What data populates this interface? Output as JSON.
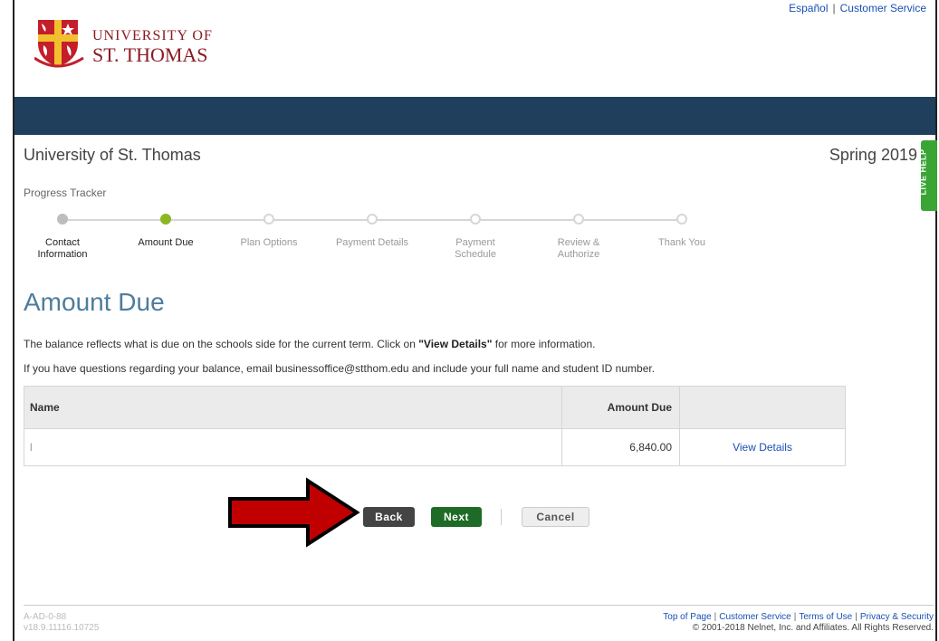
{
  "top_links": {
    "espanol": "Español",
    "customer_service": "Customer Service"
  },
  "logo": {
    "line1": "UNIVERSITY OF",
    "line2": "ST. THOMAS"
  },
  "colors": {
    "banner": "#1f3f5c",
    "title": "#4e7c9c",
    "current_step": "#8cb623",
    "next_button": "#1d6b26",
    "live_help": "#3aa535",
    "arrow": "#c00000"
  },
  "header": {
    "school": "University of St. Thomas",
    "term": "Spring 2019",
    "live_help": "LIVE HELP"
  },
  "tracker": {
    "title": "Progress Tracker",
    "steps": [
      {
        "label": "Contact Information",
        "state": "done"
      },
      {
        "label": "Amount Due",
        "state": "current"
      },
      {
        "label": "Plan Options",
        "state": "future"
      },
      {
        "label": "Payment Details",
        "state": "future"
      },
      {
        "label": "Payment Schedule",
        "state": "future"
      },
      {
        "label": "Review & Authorize",
        "state": "future"
      },
      {
        "label": "Thank You",
        "state": "future"
      }
    ]
  },
  "main": {
    "title": "Amount Due",
    "para1_prefix": "The balance reflects what is due on the schools side for the current term. Click on ",
    "para1_bold": "\"View Details\"",
    "para1_suffix": " for more information.",
    "para2": "If you have questions regarding your balance, email businessoffice@stthom.edu and include your full name and student ID number."
  },
  "table": {
    "headers": {
      "name": "Name",
      "amount": "Amount Due"
    },
    "rows": [
      {
        "name": "l",
        "amount": "6,840.00",
        "link": "View Details"
      }
    ]
  },
  "buttons": {
    "back": "Back",
    "next": "Next",
    "cancel": "Cancel"
  },
  "footer": {
    "code": "A-AD-0-88",
    "version": "v18.9.11116.10725",
    "links": {
      "top": "Top of Page",
      "customer_service": "Customer Service",
      "terms": "Terms of Use",
      "privacy": "Privacy & Security"
    },
    "copyright": "© 2001-2018 Nelnet, Inc. and Affiliates. All Rights Reserved."
  }
}
